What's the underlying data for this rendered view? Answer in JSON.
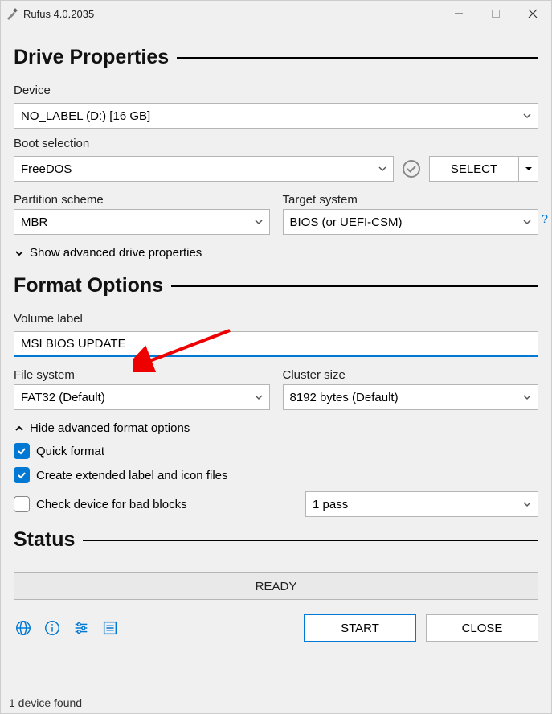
{
  "window": {
    "title": "Rufus 4.0.2035"
  },
  "sections": {
    "drive": "Drive Properties",
    "format": "Format Options",
    "status": "Status"
  },
  "device": {
    "label": "Device",
    "value": "NO_LABEL (D:) [16 GB]"
  },
  "boot": {
    "label": "Boot selection",
    "value": "FreeDOS",
    "select_btn": "SELECT"
  },
  "partition": {
    "label": "Partition scheme",
    "value": "MBR"
  },
  "target": {
    "label": "Target system",
    "value": "BIOS (or UEFI-CSM)"
  },
  "advanced_drive": "Show advanced drive properties",
  "volume": {
    "label": "Volume label",
    "value": "MSI BIOS UPDATE"
  },
  "filesystem": {
    "label": "File system",
    "value": "FAT32 (Default)"
  },
  "cluster": {
    "label": "Cluster size",
    "value": "8192 bytes (Default)"
  },
  "advanced_format": "Hide advanced format options",
  "opts": {
    "quick": "Quick format",
    "extlabel": "Create extended label and icon files",
    "badblocks": "Check device for bad blocks",
    "passes": "1 pass"
  },
  "status_text": "READY",
  "buttons": {
    "start": "START",
    "close": "CLOSE"
  },
  "footer": "1 device found"
}
